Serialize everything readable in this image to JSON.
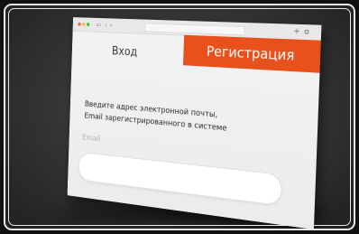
{
  "window": {
    "url": "",
    "plus_icon": "plus-icon",
    "copy_icon": "copy-icon",
    "sidebar_icon": "sidebar-icon",
    "back_icon": "chevron-left-icon",
    "forward_icon": "chevron-right-icon"
  },
  "tabs": {
    "login_label": "Вход",
    "register_label": "Регистрация",
    "active": "register"
  },
  "form": {
    "instructions_line1": "Введите адрес электронной почты,",
    "instructions_line2": "Email зарегистрированного в системе",
    "email_label": "Email",
    "email_value": "",
    "email_placeholder": ""
  },
  "colors": {
    "accent": "#e8501c",
    "window_bg": "#f0f0f0",
    "background": "#333333"
  }
}
